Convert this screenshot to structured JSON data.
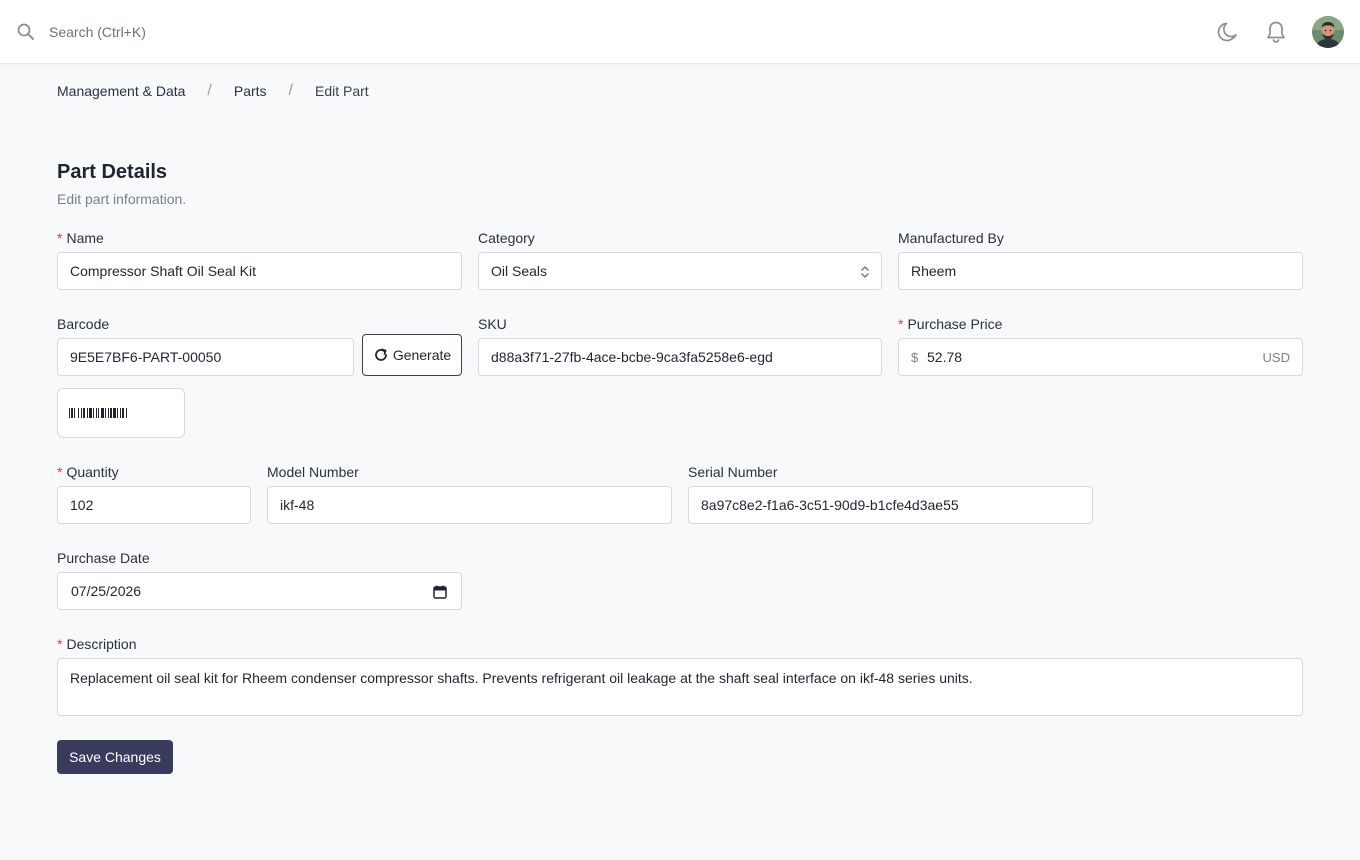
{
  "topbar": {
    "search_placeholder": "Search (Ctrl+K)",
    "icons": [
      "search-icon",
      "moon-icon",
      "bell-icon",
      "avatar"
    ]
  },
  "breadcrumb": {
    "items": [
      "Management & Data",
      "Parts",
      "Edit Part"
    ],
    "separator": "/"
  },
  "header": {
    "title": "Part Details",
    "subtitle": "Edit part information."
  },
  "form": {
    "name": {
      "label": "Name",
      "required_mark": "*",
      "value": "Compressor Shaft Oil Seal Kit"
    },
    "category": {
      "label": "Category",
      "value": "Oil Seals"
    },
    "manufactured_by": {
      "label": "Manufactured By",
      "value": "Rheem"
    },
    "barcode": {
      "label": "Barcode",
      "value": "9E5E7BF6-PART-00050",
      "generate_label": "Generate"
    },
    "sku": {
      "label": "SKU",
      "value": "d88a3f71-27fb-4ace-bcbe-9ca3fa5258e6-egd"
    },
    "purchase_price": {
      "label": "Purchase Price",
      "required_mark": "*",
      "prefix": "$",
      "value": "52.78",
      "suffix": "USD"
    },
    "quantity": {
      "label": "Quantity",
      "required_mark": "*",
      "value": "102"
    },
    "model_number": {
      "label": "Model Number",
      "value": "ikf-48"
    },
    "serial_number": {
      "label": "Serial Number",
      "value": "8a97c8e2-f1a6-3c51-90d9-b1cfe4d3ae55"
    },
    "purchase_date": {
      "label": "Purchase Date",
      "value": "07/25/2026"
    },
    "description": {
      "label": "Description",
      "required_mark": "*",
      "value": "Replacement oil seal kit for Rheem condenser compressor shafts. Prevents refrigerant oil leakage at the shaft seal interface on ikf-48 series units."
    },
    "save_label": "Save Changes"
  },
  "colors": {
    "primary_button": "#393b5c",
    "required": "#e03a3a",
    "background": "#f8f9fb"
  }
}
